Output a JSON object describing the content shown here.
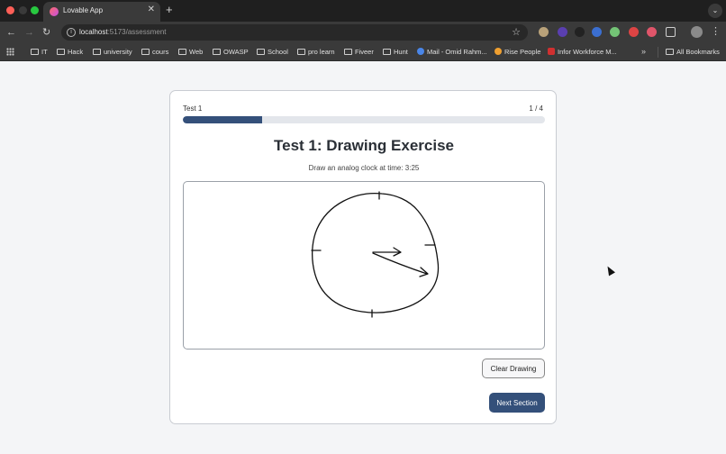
{
  "browser": {
    "tab_title": "Lovable App",
    "url_host": "localhost",
    "url_path": ":5173/assessment",
    "bookmarks": [
      "IT",
      "Hack",
      "university",
      "cours",
      "Web",
      "OWASP",
      "School",
      "pro learn",
      "Fiveer",
      "Hunt",
      "Mail - Omid Rahm...",
      "Rise People",
      "Infor Workforce M..."
    ],
    "all_bookmarks": "All Bookmarks"
  },
  "assessment": {
    "test_label": "Test 1",
    "counter": "1 / 4",
    "progress": 0.22,
    "title": "Test 1: Drawing Exercise",
    "instruction": "Draw an analog clock at time: 3:25",
    "clear_label": "Clear Drawing",
    "next_label": "Next Section",
    "accent_color": "#34507a"
  }
}
